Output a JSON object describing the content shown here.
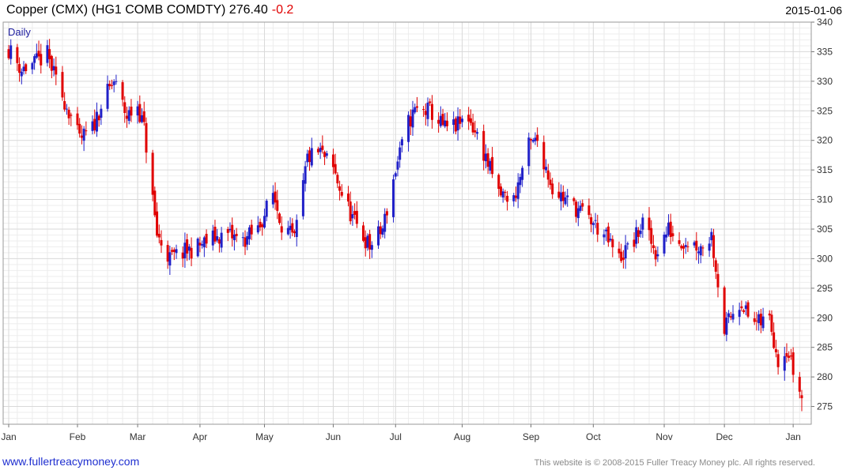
{
  "header": {
    "title": "Copper (CMX) (HG1 COMB COMDTY) 276.40",
    "change": "-0.2",
    "date": "2015-01-06"
  },
  "footer": {
    "website": "www.fullertreacymoney.com",
    "copyright": "This website is © 2008-2015 Fuller Treacy Money plc. All rights reserved."
  },
  "colors": {
    "up": "#2020c8",
    "down": "#e00000",
    "grid": "#d9d9d9",
    "frame": "#9a9a9a",
    "label": "#2020a0"
  },
  "chart_data": {
    "type": "candlestick",
    "period_label": "Daily",
    "ylim": [
      272,
      340
    ],
    "y_ticks": [
      275,
      280,
      285,
      290,
      295,
      300,
      305,
      310,
      315,
      320,
      325,
      330,
      335,
      340
    ],
    "x_tick_labels": [
      "Jan",
      "Feb",
      "Mar",
      "Apr",
      "May",
      "Jun",
      "Jul",
      "Aug",
      "Sep",
      "Oct",
      "Nov",
      "Dec",
      "Jan"
    ],
    "x_tick_dates": [
      "2014-01-02",
      "2014-02-03",
      "2014-03-03",
      "2014-04-01",
      "2014-05-01",
      "2014-06-02",
      "2014-07-01",
      "2014-08-01",
      "2014-09-02",
      "2014-10-01",
      "2014-11-03",
      "2014-12-01",
      "2015-01-02"
    ],
    "date_range": [
      "2014-01-02",
      "2015-01-06"
    ],
    "last_close": 276.4,
    "close_path": [
      [
        "2014-01-02",
        335.5
      ],
      [
        "2014-01-08",
        332
      ],
      [
        "2014-01-14",
        333
      ],
      [
        "2014-01-20",
        334.5
      ],
      [
        "2014-01-24",
        330
      ],
      [
        "2014-01-30",
        325
      ],
      [
        "2014-02-04",
        320
      ],
      [
        "2014-02-10",
        322
      ],
      [
        "2014-02-14",
        326
      ],
      [
        "2014-02-20",
        330
      ],
      [
        "2014-02-26",
        324
      ],
      [
        "2014-03-03",
        326
      ],
      [
        "2014-03-06",
        322
      ],
      [
        "2014-03-12",
        304
      ],
      [
        "2014-03-18",
        300
      ],
      [
        "2014-03-24",
        301
      ],
      [
        "2014-03-31",
        302
      ],
      [
        "2014-04-07",
        303.5
      ],
      [
        "2014-04-14",
        304
      ],
      [
        "2014-04-21",
        303
      ],
      [
        "2014-04-28",
        305
      ],
      [
        "2014-05-05",
        311
      ],
      [
        "2014-05-09",
        306
      ],
      [
        "2014-05-15",
        303
      ],
      [
        "2014-05-21",
        317
      ],
      [
        "2014-05-27",
        318
      ],
      [
        "2014-06-02",
        315
      ],
      [
        "2014-06-06",
        311
      ],
      [
        "2014-06-12",
        306
      ],
      [
        "2014-06-19",
        302
      ],
      [
        "2014-06-25",
        305
      ],
      [
        "2014-07-01",
        315
      ],
      [
        "2014-07-07",
        323
      ],
      [
        "2014-07-10",
        325
      ],
      [
        "2014-07-17",
        325
      ],
      [
        "2014-07-24",
        322
      ],
      [
        "2014-07-30",
        322.5
      ],
      [
        "2014-08-04",
        324
      ],
      [
        "2014-08-11",
        318
      ],
      [
        "2014-08-18",
        311
      ],
      [
        "2014-08-25",
        310
      ],
      [
        "2014-09-01",
        319
      ],
      [
        "2014-09-05",
        320
      ],
      [
        "2014-09-12",
        312
      ],
      [
        "2014-09-18",
        310
      ],
      [
        "2014-09-25",
        308
      ],
      [
        "2014-10-01",
        306
      ],
      [
        "2014-10-06",
        304
      ],
      [
        "2014-10-13",
        300
      ],
      [
        "2014-10-20",
        303
      ],
      [
        "2014-10-24",
        306
      ],
      [
        "2014-10-30",
        301
      ],
      [
        "2014-11-05",
        305
      ],
      [
        "2014-11-10",
        303
      ],
      [
        "2014-11-14",
        303
      ],
      [
        "2014-11-20",
        302
      ],
      [
        "2014-11-25",
        304
      ],
      [
        "2014-12-01",
        288
      ],
      [
        "2014-12-05",
        291
      ],
      [
        "2014-12-09",
        293
      ],
      [
        "2014-12-12",
        290
      ],
      [
        "2014-12-17",
        289
      ],
      [
        "2014-12-22",
        290
      ],
      [
        "2014-12-26",
        283
      ],
      [
        "2014-12-30",
        285
      ],
      [
        "2015-01-02",
        281
      ],
      [
        "2015-01-06",
        276.4
      ]
    ]
  }
}
